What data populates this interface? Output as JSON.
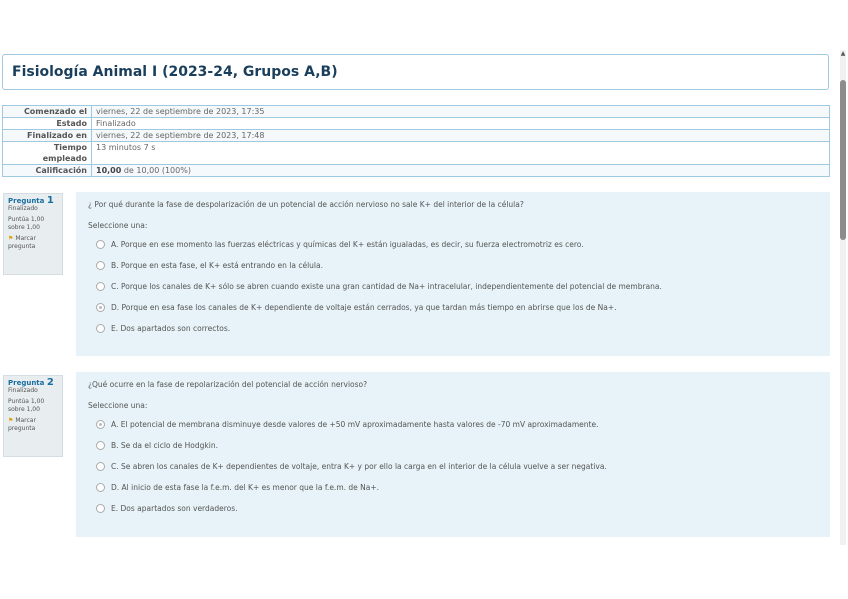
{
  "course_title": "Fisiología Animal I (2023-24, Grupos A,B)",
  "summary": [
    {
      "label": "Comenzado el",
      "value": "viernes, 22 de septiembre de 2023, 17:35"
    },
    {
      "label": "Estado",
      "value": "Finalizado"
    },
    {
      "label": "Finalizado en",
      "value": "viernes, 22 de septiembre de 2023, 17:48"
    },
    {
      "label": "Tiempo empleado",
      "value": "13 minutos 7 s"
    },
    {
      "label": "Calificación",
      "value_bold": "10,00",
      "value_rest": " de 10,00 (100%)"
    }
  ],
  "questions": [
    {
      "label": "Pregunta",
      "number": "1",
      "status": "Finalizado",
      "points": "Puntúa 1,00 sobre 1,00",
      "flag": "Marcar pregunta",
      "text": "¿ Por qué durante la fase de despolarización de un potencial de acción nervioso no sale K+ del interior de la célula?",
      "prompt": "Seleccione una:",
      "options": [
        {
          "label": "A. Porque en ese momento las fuerzas eléctricas y químicas del K+ están igualadas, es decir, su fuerza electromotriz es cero.",
          "checked": false
        },
        {
          "label": "B. Porque en esta fase, el K+ está entrando en la célula.",
          "checked": false
        },
        {
          "label": "C. Porque los canales de K+ sólo se abren cuando existe una gran cantidad de Na+ intracelular, independientemente del potencial de membrana.",
          "checked": false
        },
        {
          "label": "D. Porque en esa fase los canales de K+ dependiente de voltaje están cerrados, ya que tardan más tiempo en abrirse que los de Na+.",
          "checked": true
        },
        {
          "label": "E. Dos apartados son correctos.",
          "checked": false
        }
      ]
    },
    {
      "label": "Pregunta",
      "number": "2",
      "status": "Finalizado",
      "points": "Puntúa 1,00 sobre 1,00",
      "flag": "Marcar pregunta",
      "text": "¿Qué ocurre en la fase de repolarización del potencial de acción nervioso?",
      "prompt": "Seleccione una:",
      "options": [
        {
          "label": "A. El potencial de membrana disminuye desde valores de +50 mV aproximadamente hasta valores de -70 mV aproximadamente.",
          "checked": true
        },
        {
          "label": "B. Se da el ciclo de Hodgkin.",
          "checked": false
        },
        {
          "label": "C. Se abren los canales de K+ dependientes de voltaje, entra K+ y por ello la carga en el interior de la célula vuelve a ser negativa.",
          "checked": false
        },
        {
          "label": "D. Al inicio de esta fase la f.e.m. del K+ es menor que la f.e.m. de Na+.",
          "checked": false
        },
        {
          "label": "E. Dos apartados son verdaderos.",
          "checked": false
        }
      ]
    }
  ]
}
